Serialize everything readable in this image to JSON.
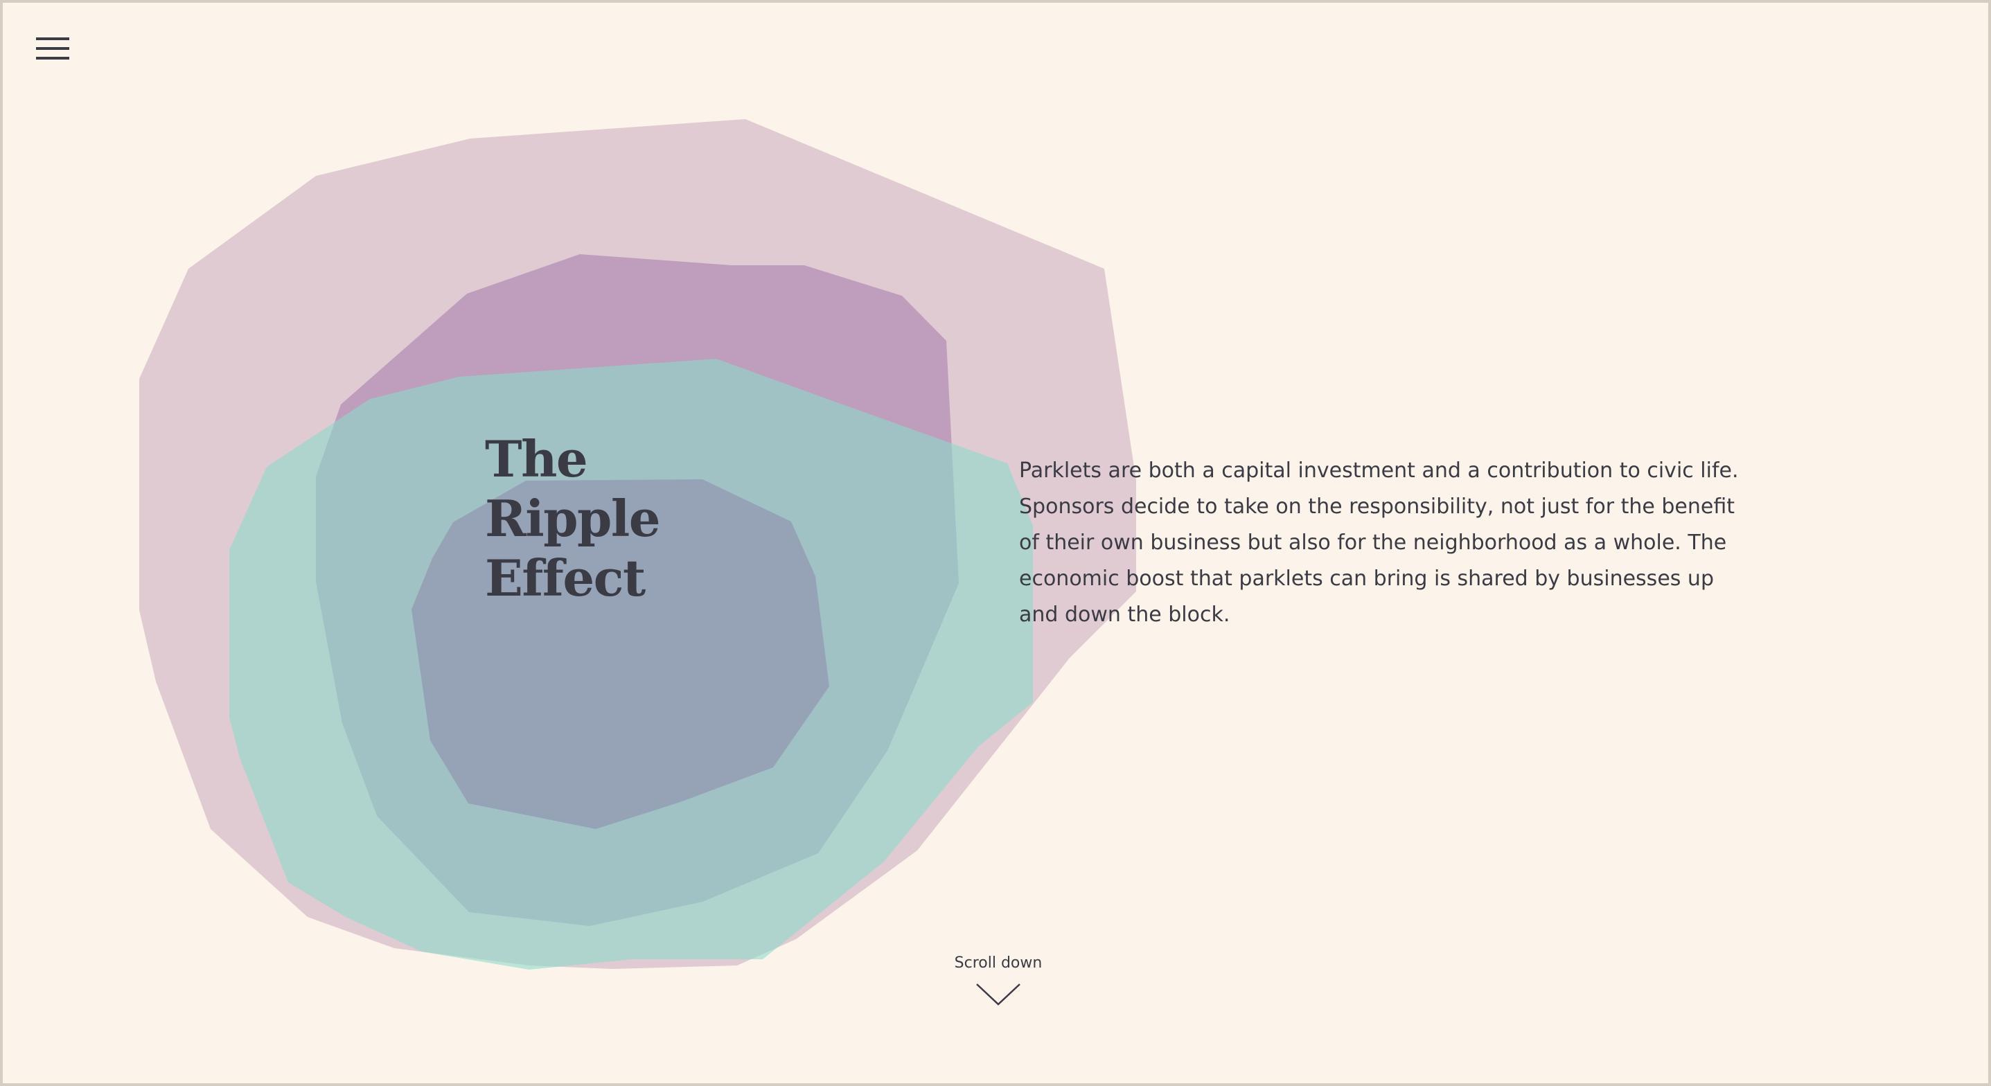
{
  "page": {
    "background": "#fcf4ea",
    "text_color": "#3a3b44"
  },
  "nav": {
    "menu_icon": "hamburger-menu-icon"
  },
  "hero": {
    "title_line_1": "The Ripple",
    "title_line_2": "Effect",
    "body": "Parklets are both a capital investment and a contribution to civic life. Sponsors decide to take on the responsibility, not just for the benefit of their own business but also for the neighborhood as a whole. The economic boost that parklets can bring is shared by businesses up and down the block."
  },
  "ripple_colors": {
    "outer": "#c9a9bd",
    "middle": "#a37aaa",
    "teal": "#8edbc9",
    "core": "#8e8aad"
  },
  "scroll": {
    "label": "Scroll down",
    "icon": "chevron-down-icon"
  }
}
